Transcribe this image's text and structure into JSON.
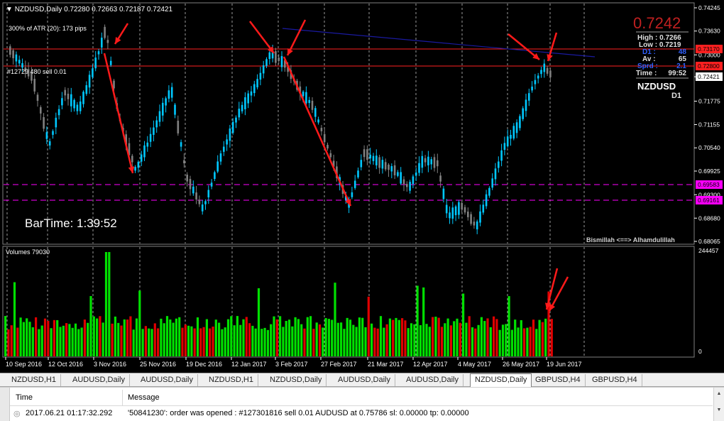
{
  "chart_header": {
    "title": "NZDUSD,Daily",
    "ohlc": "0.72280 0.72663 0.72187 0.72421",
    "atr": "300% of ATR (20):   173 pips",
    "order_label": "#12729 480 sell 0.01"
  },
  "bar_time": "BarTime:   1:39:52",
  "footer_note": "Bismillah <==> Alhamdulillah",
  "info_panel": {
    "price": "0.7242",
    "high": "High : 0.7266",
    "low": "Low : 0.7219",
    "d1_label": "D1 :",
    "d1_value": "48",
    "av_label": "Av :",
    "av_value": "65",
    "sprd_label": "Sprd :",
    "sprd_value": "2.1",
    "time_label": "Time :",
    "time_value": "99:52",
    "symbol": "NZDUSD",
    "tf": "D1"
  },
  "volume_label": "Volumes 79030",
  "volume_axis": [
    "244457",
    "0"
  ],
  "price_axis": [
    "0.74245",
    "0.73630",
    "0.73000",
    "0.72421",
    "0.71775",
    "0.71155",
    "0.70540",
    "0.69925",
    "0.69300",
    "0.68680",
    "0.68065"
  ],
  "price_tags": {
    "red1": "0.73170",
    "red2": "0.72800",
    "mag1": "0.69583",
    "mag2": "0.69161",
    "current": "0.72421"
  },
  "date_axis": [
    "10 Sep 2016",
    "12 Oct 2016",
    "3 Nov 2016",
    "25 Nov 2016",
    "19 Dec 2016",
    "12 Jan 2017",
    "3 Feb 2017",
    "27 Feb 2017",
    "21 Mar 2017",
    "12 Apr 2017",
    "4 May 2017",
    "26 May 2017",
    "19 Jun 2017"
  ],
  "tabs": [
    "NZDUSD,H1",
    "AUDUSD,Daily",
    "AUDUSD,Daily",
    "NZDUSD,H1",
    "NZDUSD,Daily",
    "AUDUSD,Daily",
    "AUDUSD,Daily",
    "NZDUSD,Daily",
    "GBPUSD,H4",
    "GBPUSD,H4"
  ],
  "active_tab": 7,
  "terminal": {
    "col_time": "Time",
    "col_message": "Message",
    "row_time": "2017.06.21 01:17:32.292",
    "row_message": "'50841230': order was opened : #127301816 sell 0.01 AUDUSD at 0.75786 sl: 0.00000 tp: 0.00000"
  },
  "colors": {
    "bull": "#00c8ff",
    "bear": "#808080",
    "vol_up": "#00e000",
    "vol_down": "#e00000",
    "red_line": "#ff2020",
    "magenta": "#ff00ff",
    "trend": "#1a1aa0",
    "arrow": "#ff1a1a"
  }
}
